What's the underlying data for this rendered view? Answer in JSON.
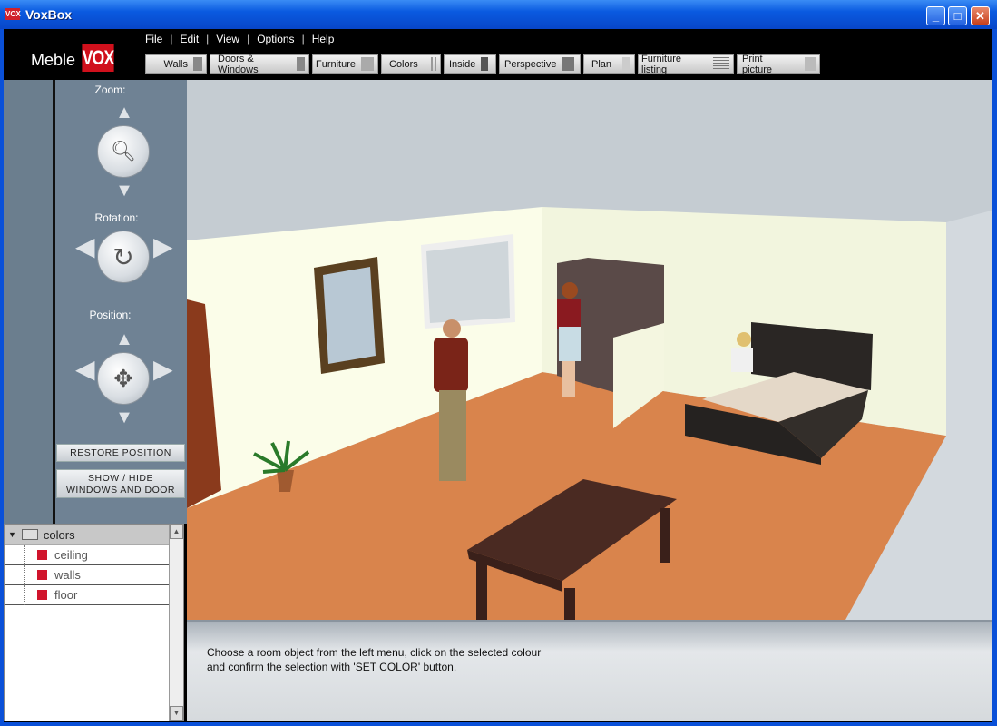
{
  "window": {
    "title": "VoxBox",
    "icon_text": "VOX",
    "buttons": [
      "minimize",
      "maximize",
      "close"
    ]
  },
  "logo": {
    "meble": "Meble",
    "vox": "VOX"
  },
  "menu": [
    "File",
    "Edit",
    "View",
    "Options",
    "Help"
  ],
  "toolbar": [
    "Walls",
    "Doors & Windows",
    "Furniture",
    "Colors",
    "Inside",
    "Perspective",
    "Plan",
    "Furniture listing",
    "Print picture"
  ],
  "controls": {
    "zoom": "Zoom:",
    "rotation": "Rotation:",
    "position": "Position:",
    "restore": "RESTORE POSITION",
    "show_hide_1": "SHOW / HIDE",
    "show_hide_2": "WINDOWS AND DOOR"
  },
  "tree": {
    "root": "colors",
    "items": [
      {
        "label": "ceiling",
        "color": "#d0142c"
      },
      {
        "label": "walls",
        "color": "#d0142c"
      },
      {
        "label": "floor",
        "color": "#d0142c"
      }
    ]
  },
  "status": {
    "line1": "Choose a room object from the left menu, click on the selected colour",
    "line2": "and confirm the selection with 'SET COLOR' button."
  },
  "colors": {
    "floor": "#d9844c",
    "walls": "#fbfde9",
    "background": "#c5ccd2"
  }
}
